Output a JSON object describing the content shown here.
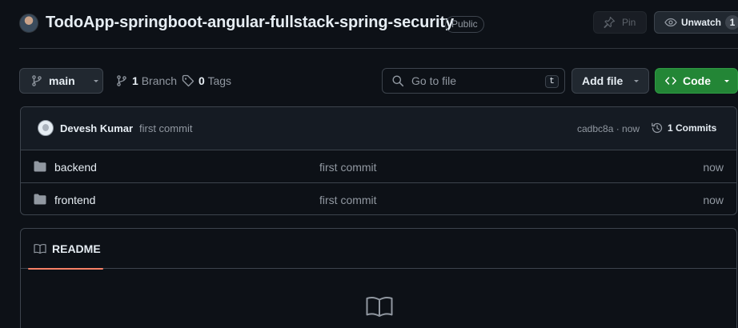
{
  "repo": {
    "title": "TodoApp-springboot-angular-fullstack-spring-security",
    "visibility": "Public",
    "pin_label": "Pin",
    "watch_label": "Unwatch",
    "watch_count": "1"
  },
  "toolbar": {
    "branch": "main",
    "branch_count": "1",
    "branch_label": "Branch",
    "tag_count": "0",
    "tag_label": "Tags",
    "search_placeholder": "Go to file",
    "search_shortcut": "t",
    "add_file_label": "Add file",
    "code_label": "Code"
  },
  "commit": {
    "author": "Devesh Kumar",
    "message": "first commit",
    "sha_time": "cadbc8a · now",
    "commits_label": "1 Commits"
  },
  "files": [
    {
      "name": "backend",
      "commit": "first commit",
      "time": "now"
    },
    {
      "name": "frontend",
      "commit": "first commit",
      "time": "now"
    }
  ],
  "readme": {
    "tab_label": "README"
  },
  "colors": {
    "background": "#0d1117",
    "code_button": "#238636",
    "readme_underline": "#f78166",
    "muted_text": "#9198a1"
  },
  "icons": [
    "pin-icon",
    "eye-icon",
    "git-branch-icon",
    "tag-icon",
    "search-icon",
    "code-icon",
    "history-icon",
    "folder-icon",
    "book-icon"
  ]
}
